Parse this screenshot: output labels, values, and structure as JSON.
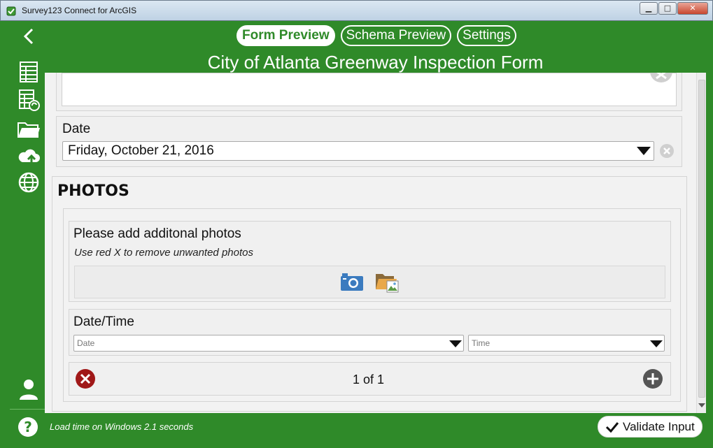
{
  "window": {
    "title": "Survey123 Connect for ArcGIS",
    "minimize": "▁",
    "maximize": "□",
    "close": "✕"
  },
  "tabs": [
    {
      "label": "Form Preview",
      "active": true
    },
    {
      "label": "Schema Preview",
      "active": false
    },
    {
      "label": "Settings",
      "active": false
    }
  ],
  "form": {
    "title": "City of Atlanta Greenway Inspection Form",
    "date_label": "Date",
    "date_value": "Friday, October 21, 2016",
    "section_title": "PHOTOS",
    "photos_label": "Please add additonal photos",
    "photos_hint": "Use red X to remove unwanted photos",
    "datetime_label": "Date/Time",
    "date_placeholder": "Date",
    "time_placeholder": "Time",
    "pager": "1 of 1"
  },
  "footer": {
    "load_time": "Load time on Windows 2.1 seconds",
    "validate_label": "Validate Input"
  },
  "colors": {
    "brand_green": "#2f8a29",
    "remove_red": "#a01818",
    "camera_blue": "#3b7bbf"
  }
}
